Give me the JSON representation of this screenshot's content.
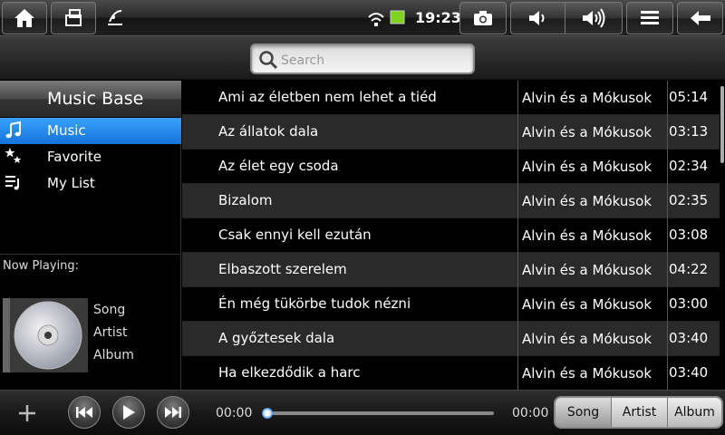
{
  "statusbar": {
    "time": "19:23",
    "icons": [
      "home-icon",
      "rotate-icon",
      "signal-icon",
      "wifi-icon",
      "battery-icon",
      "camera-icon",
      "volume-down-icon",
      "volume-up-icon",
      "menu-icon",
      "back-icon"
    ]
  },
  "search": {
    "placeholder": "Search"
  },
  "sidebar": {
    "title": "Music Base",
    "items": [
      {
        "label": "Music",
        "icon": "music-note-icon",
        "selected": true
      },
      {
        "label": "Favorite",
        "icon": "star-icon",
        "selected": false
      },
      {
        "label": "My List",
        "icon": "playlist-icon",
        "selected": false
      }
    ]
  },
  "now_playing": {
    "label": "Now Playing:",
    "song": "Song",
    "artist": "Artist",
    "album": "Album"
  },
  "tracks": [
    {
      "title": "Ami az életben nem lehet a tiéd",
      "artist": "Alvin és a Mókusok",
      "duration": "05:14"
    },
    {
      "title": "Az állatok dala",
      "artist": "Alvin és a Mókusok",
      "duration": "03:13"
    },
    {
      "title": "Az élet egy csoda",
      "artist": "Alvin és a Mókusok",
      "duration": "02:34"
    },
    {
      "title": "Bizalom",
      "artist": "Alvin és a Mókusok",
      "duration": "02:35"
    },
    {
      "title": "Csak ennyi kell ezután",
      "artist": "Alvin és a Mókusok",
      "duration": "03:08"
    },
    {
      "title": "Elbaszott szerelem",
      "artist": "Alvin és a Mókusok",
      "duration": "04:22"
    },
    {
      "title": "Én még tükörbe tudok nézni",
      "artist": "Alvin és a Mókusok",
      "duration": "03:00"
    },
    {
      "title": "A győztesek dala",
      "artist": "Alvin és a Mókusok",
      "duration": "03:40"
    },
    {
      "title": "Ha elkezdődik a harc",
      "artist": "Alvin és a Mókusok",
      "duration": "03:40"
    }
  ],
  "player": {
    "elapsed": "00:00",
    "total": "00:00",
    "progress": 0
  },
  "sort": {
    "options": [
      "Song",
      "Artist",
      "Album"
    ],
    "selected": "Song"
  },
  "colors": {
    "accent": "#1f86f0",
    "alt_row": "#2a2a2a"
  }
}
